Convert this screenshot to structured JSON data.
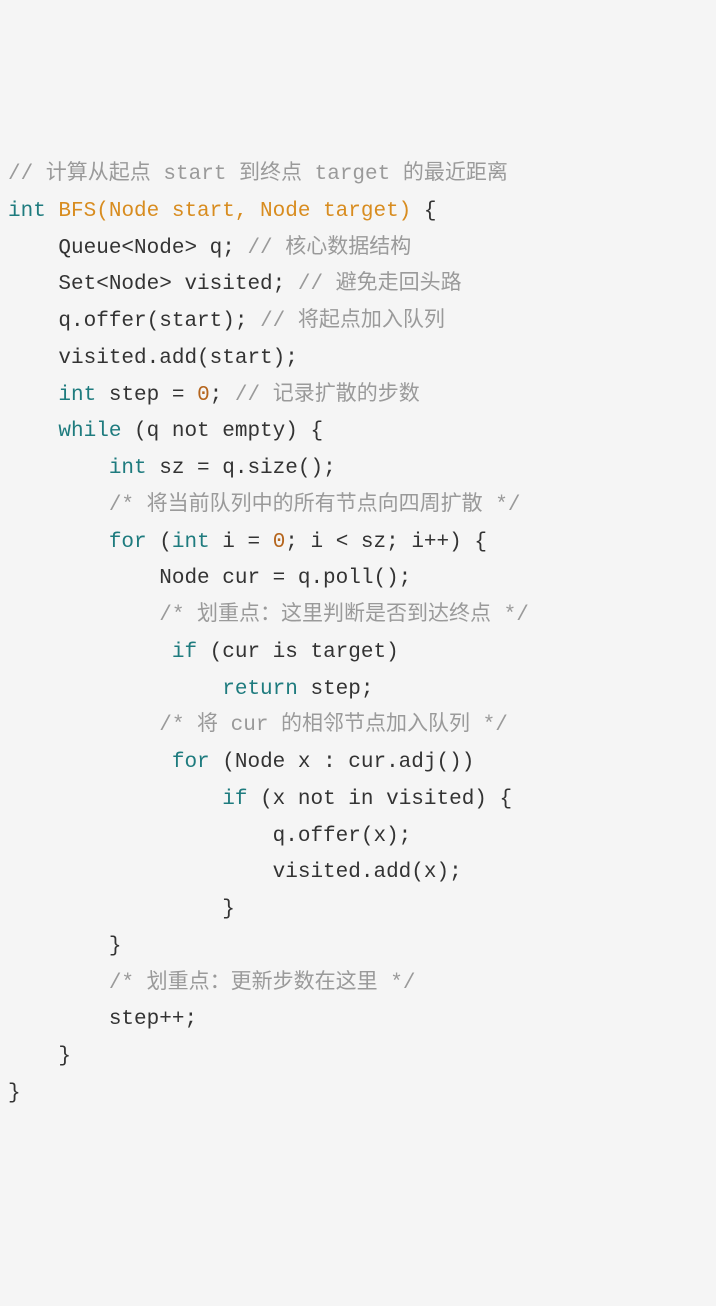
{
  "code": {
    "lines": [
      {
        "indent": 0,
        "segments": [
          {
            "cls": "tok-comment",
            "t": "// 计算从起点 start 到终点 target 的最近距离"
          }
        ]
      },
      {
        "indent": 0,
        "segments": [
          {
            "cls": "tok-keyword",
            "t": "int"
          },
          {
            "cls": "tok-plain",
            "t": " "
          },
          {
            "cls": "tok-func",
            "t": "BFS"
          },
          {
            "cls": "tok-params",
            "t": "(Node start, Node target)"
          },
          {
            "cls": "tok-plain",
            "t": " {"
          }
        ]
      },
      {
        "indent": 1,
        "segments": [
          {
            "cls": "tok-plain",
            "t": "Queue<Node> q; "
          },
          {
            "cls": "tok-comment",
            "t": "// 核心数据结构"
          }
        ]
      },
      {
        "indent": 1,
        "segments": [
          {
            "cls": "tok-plain",
            "t": "Set<Node> visited; "
          },
          {
            "cls": "tok-comment",
            "t": "// 避免走回头路"
          }
        ]
      },
      {
        "indent": 0,
        "segments": [
          {
            "cls": "tok-plain",
            "t": ""
          }
        ]
      },
      {
        "indent": 1,
        "segments": [
          {
            "cls": "tok-plain",
            "t": "q.offer(start); "
          },
          {
            "cls": "tok-comment",
            "t": "// 将起点加入队列"
          }
        ]
      },
      {
        "indent": 1,
        "segments": [
          {
            "cls": "tok-plain",
            "t": "visited.add(start);"
          }
        ]
      },
      {
        "indent": 1,
        "segments": [
          {
            "cls": "tok-keyword",
            "t": "int"
          },
          {
            "cls": "tok-plain",
            "t": " step = "
          },
          {
            "cls": "tok-num",
            "t": "0"
          },
          {
            "cls": "tok-plain",
            "t": "; "
          },
          {
            "cls": "tok-comment",
            "t": "// 记录扩散的步数"
          }
        ]
      },
      {
        "indent": 0,
        "segments": [
          {
            "cls": "tok-plain",
            "t": ""
          }
        ]
      },
      {
        "indent": 1,
        "segments": [
          {
            "cls": "tok-keyword",
            "t": "while"
          },
          {
            "cls": "tok-plain",
            "t": " (q not empty) {"
          }
        ]
      },
      {
        "indent": 2,
        "segments": [
          {
            "cls": "tok-keyword",
            "t": "int"
          },
          {
            "cls": "tok-plain",
            "t": " sz = q.size();"
          }
        ]
      },
      {
        "indent": 2,
        "segments": [
          {
            "cls": "tok-comment",
            "t": "/* 将当前队列中的所有节点向四周扩散 */"
          }
        ]
      },
      {
        "indent": 2,
        "segments": [
          {
            "cls": "tok-keyword",
            "t": "for"
          },
          {
            "cls": "tok-plain",
            "t": " ("
          },
          {
            "cls": "tok-keyword",
            "t": "int"
          },
          {
            "cls": "tok-plain",
            "t": " i = "
          },
          {
            "cls": "tok-num",
            "t": "0"
          },
          {
            "cls": "tok-plain",
            "t": "; i < sz; i++) {"
          }
        ]
      },
      {
        "indent": 3,
        "segments": [
          {
            "cls": "tok-plain",
            "t": "Node cur = q.poll();"
          }
        ]
      },
      {
        "indent": 3,
        "segments": [
          {
            "cls": "tok-comment",
            "t": "/* 划重点：这里判断是否到达终点 */"
          }
        ]
      },
      {
        "indent": 3,
        "segments": [
          {
            "cls": "tok-plain",
            "t": " "
          },
          {
            "cls": "tok-keyword",
            "t": "if"
          },
          {
            "cls": "tok-plain",
            "t": " (cur is target)"
          }
        ]
      },
      {
        "indent": 4,
        "segments": [
          {
            "cls": "tok-plain",
            "t": " "
          },
          {
            "cls": "tok-keyword",
            "t": "return"
          },
          {
            "cls": "tok-plain",
            "t": " step;"
          }
        ]
      },
      {
        "indent": 3,
        "segments": [
          {
            "cls": "tok-comment",
            "t": "/* 将 cur 的相邻节点加入队列 */"
          }
        ]
      },
      {
        "indent": 3,
        "segments": [
          {
            "cls": "tok-plain",
            "t": " "
          },
          {
            "cls": "tok-keyword",
            "t": "for"
          },
          {
            "cls": "tok-plain",
            "t": " (Node x : cur.adj())"
          }
        ]
      },
      {
        "indent": 4,
        "segments": [
          {
            "cls": "tok-plain",
            "t": " "
          },
          {
            "cls": "tok-keyword",
            "t": "if"
          },
          {
            "cls": "tok-plain",
            "t": " (x not in visited) {"
          }
        ]
      },
      {
        "indent": 5,
        "segments": [
          {
            "cls": "tok-plain",
            "t": " q.offer(x);"
          }
        ]
      },
      {
        "indent": 5,
        "segments": [
          {
            "cls": "tok-plain",
            "t": " visited.add(x);"
          }
        ]
      },
      {
        "indent": 4,
        "segments": [
          {
            "cls": "tok-plain",
            "t": " }"
          }
        ]
      },
      {
        "indent": 2,
        "segments": [
          {
            "cls": "tok-plain",
            "t": "}"
          }
        ]
      },
      {
        "indent": 2,
        "segments": [
          {
            "cls": "tok-comment",
            "t": "/* 划重点：更新步数在这里 */"
          }
        ]
      },
      {
        "indent": 2,
        "segments": [
          {
            "cls": "tok-plain",
            "t": "step++;"
          }
        ]
      },
      {
        "indent": 1,
        "segments": [
          {
            "cls": "tok-plain",
            "t": "}"
          }
        ]
      },
      {
        "indent": 0,
        "segments": [
          {
            "cls": "tok-plain",
            "t": "}"
          }
        ]
      }
    ],
    "indent_unit": "    "
  }
}
